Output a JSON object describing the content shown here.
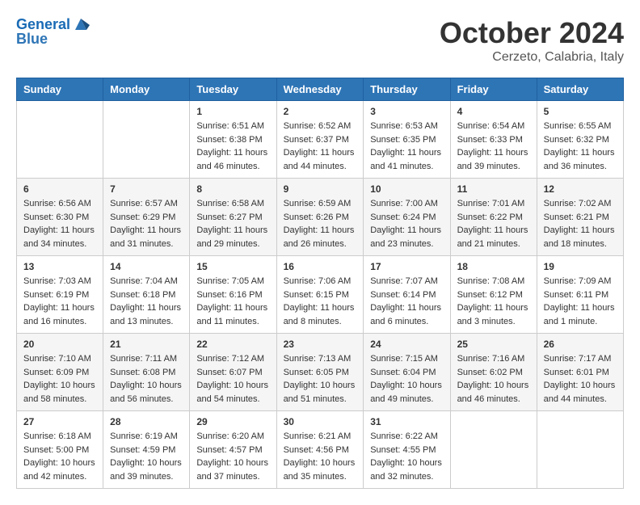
{
  "header": {
    "logo_line1": "General",
    "logo_line2": "Blue",
    "month_title": "October 2024",
    "location": "Cerzeto, Calabria, Italy"
  },
  "days_of_week": [
    "Sunday",
    "Monday",
    "Tuesday",
    "Wednesday",
    "Thursday",
    "Friday",
    "Saturday"
  ],
  "weeks": [
    [
      {
        "day": "",
        "info": ""
      },
      {
        "day": "",
        "info": ""
      },
      {
        "day": "1",
        "info": "Sunrise: 6:51 AM\nSunset: 6:38 PM\nDaylight: 11 hours and 46 minutes."
      },
      {
        "day": "2",
        "info": "Sunrise: 6:52 AM\nSunset: 6:37 PM\nDaylight: 11 hours and 44 minutes."
      },
      {
        "day": "3",
        "info": "Sunrise: 6:53 AM\nSunset: 6:35 PM\nDaylight: 11 hours and 41 minutes."
      },
      {
        "day": "4",
        "info": "Sunrise: 6:54 AM\nSunset: 6:33 PM\nDaylight: 11 hours and 39 minutes."
      },
      {
        "day": "5",
        "info": "Sunrise: 6:55 AM\nSunset: 6:32 PM\nDaylight: 11 hours and 36 minutes."
      }
    ],
    [
      {
        "day": "6",
        "info": "Sunrise: 6:56 AM\nSunset: 6:30 PM\nDaylight: 11 hours and 34 minutes."
      },
      {
        "day": "7",
        "info": "Sunrise: 6:57 AM\nSunset: 6:29 PM\nDaylight: 11 hours and 31 minutes."
      },
      {
        "day": "8",
        "info": "Sunrise: 6:58 AM\nSunset: 6:27 PM\nDaylight: 11 hours and 29 minutes."
      },
      {
        "day": "9",
        "info": "Sunrise: 6:59 AM\nSunset: 6:26 PM\nDaylight: 11 hours and 26 minutes."
      },
      {
        "day": "10",
        "info": "Sunrise: 7:00 AM\nSunset: 6:24 PM\nDaylight: 11 hours and 23 minutes."
      },
      {
        "day": "11",
        "info": "Sunrise: 7:01 AM\nSunset: 6:22 PM\nDaylight: 11 hours and 21 minutes."
      },
      {
        "day": "12",
        "info": "Sunrise: 7:02 AM\nSunset: 6:21 PM\nDaylight: 11 hours and 18 minutes."
      }
    ],
    [
      {
        "day": "13",
        "info": "Sunrise: 7:03 AM\nSunset: 6:19 PM\nDaylight: 11 hours and 16 minutes."
      },
      {
        "day": "14",
        "info": "Sunrise: 7:04 AM\nSunset: 6:18 PM\nDaylight: 11 hours and 13 minutes."
      },
      {
        "day": "15",
        "info": "Sunrise: 7:05 AM\nSunset: 6:16 PM\nDaylight: 11 hours and 11 minutes."
      },
      {
        "day": "16",
        "info": "Sunrise: 7:06 AM\nSunset: 6:15 PM\nDaylight: 11 hours and 8 minutes."
      },
      {
        "day": "17",
        "info": "Sunrise: 7:07 AM\nSunset: 6:14 PM\nDaylight: 11 hours and 6 minutes."
      },
      {
        "day": "18",
        "info": "Sunrise: 7:08 AM\nSunset: 6:12 PM\nDaylight: 11 hours and 3 minutes."
      },
      {
        "day": "19",
        "info": "Sunrise: 7:09 AM\nSunset: 6:11 PM\nDaylight: 11 hours and 1 minute."
      }
    ],
    [
      {
        "day": "20",
        "info": "Sunrise: 7:10 AM\nSunset: 6:09 PM\nDaylight: 10 hours and 58 minutes."
      },
      {
        "day": "21",
        "info": "Sunrise: 7:11 AM\nSunset: 6:08 PM\nDaylight: 10 hours and 56 minutes."
      },
      {
        "day": "22",
        "info": "Sunrise: 7:12 AM\nSunset: 6:07 PM\nDaylight: 10 hours and 54 minutes."
      },
      {
        "day": "23",
        "info": "Sunrise: 7:13 AM\nSunset: 6:05 PM\nDaylight: 10 hours and 51 minutes."
      },
      {
        "day": "24",
        "info": "Sunrise: 7:15 AM\nSunset: 6:04 PM\nDaylight: 10 hours and 49 minutes."
      },
      {
        "day": "25",
        "info": "Sunrise: 7:16 AM\nSunset: 6:02 PM\nDaylight: 10 hours and 46 minutes."
      },
      {
        "day": "26",
        "info": "Sunrise: 7:17 AM\nSunset: 6:01 PM\nDaylight: 10 hours and 44 minutes."
      }
    ],
    [
      {
        "day": "27",
        "info": "Sunrise: 6:18 AM\nSunset: 5:00 PM\nDaylight: 10 hours and 42 minutes."
      },
      {
        "day": "28",
        "info": "Sunrise: 6:19 AM\nSunset: 4:59 PM\nDaylight: 10 hours and 39 minutes."
      },
      {
        "day": "29",
        "info": "Sunrise: 6:20 AM\nSunset: 4:57 PM\nDaylight: 10 hours and 37 minutes."
      },
      {
        "day": "30",
        "info": "Sunrise: 6:21 AM\nSunset: 4:56 PM\nDaylight: 10 hours and 35 minutes."
      },
      {
        "day": "31",
        "info": "Sunrise: 6:22 AM\nSunset: 4:55 PM\nDaylight: 10 hours and 32 minutes."
      },
      {
        "day": "",
        "info": ""
      },
      {
        "day": "",
        "info": ""
      }
    ]
  ]
}
